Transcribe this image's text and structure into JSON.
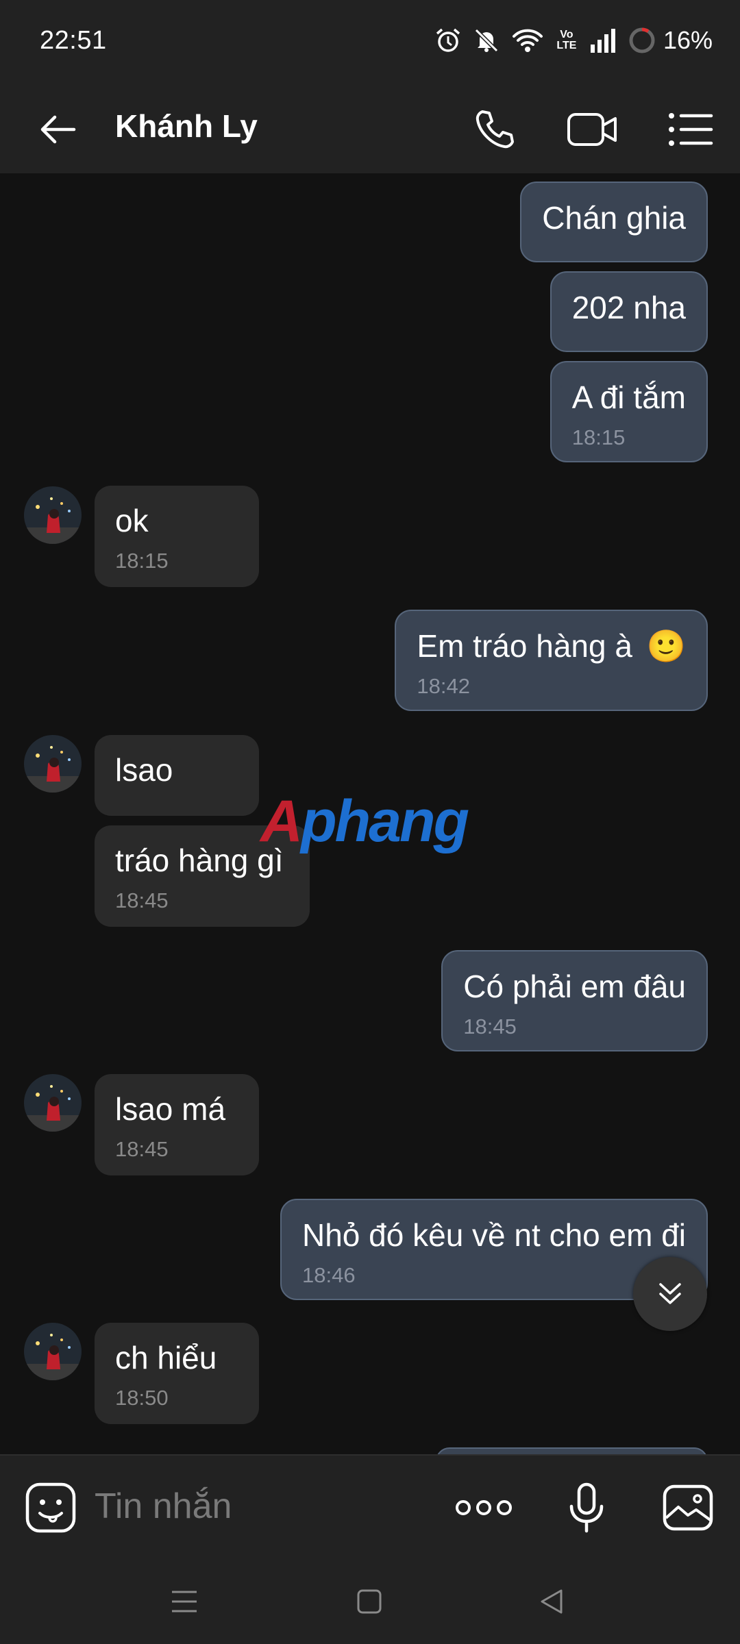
{
  "status_bar": {
    "time": "22:51",
    "volte_top": "Vo",
    "volte_bottom": "LTE",
    "battery_percent": "16%",
    "icons": [
      "alarm-icon",
      "mute-bell-icon",
      "wifi-icon",
      "volte-icon",
      "signal-icon",
      "battery-ring-icon"
    ]
  },
  "header": {
    "contact_name": "Khánh Ly",
    "icons": [
      "back-arrow-icon",
      "phone-icon",
      "video-call-icon",
      "menu-list-icon"
    ]
  },
  "messages": [
    {
      "direction": "out",
      "text": "Chán ghia",
      "time": ""
    },
    {
      "direction": "out",
      "text": "202 nha",
      "time": ""
    },
    {
      "direction": "out",
      "text": "A đi tắm",
      "time": "18:15"
    },
    {
      "direction": "in",
      "text": "ok",
      "time": "18:15"
    },
    {
      "direction": "out",
      "text": "Em tráo hàng à",
      "emoji": "🙂",
      "time": "18:42"
    },
    {
      "direction": "in",
      "text": "lsao",
      "time": ""
    },
    {
      "direction": "in",
      "text": "tráo hàng gì",
      "time": "18:45"
    },
    {
      "direction": "out",
      "text": "Có phải em đâu",
      "time": "18:45"
    },
    {
      "direction": "in",
      "text": "lsao má",
      "time": "18:45"
    },
    {
      "direction": "out",
      "text": "Nhỏ đó kêu về nt cho em đi",
      "time": "18:46"
    },
    {
      "direction": "in",
      "text": "ch hiểu",
      "time": "18:50"
    }
  ],
  "watermark": {
    "part1": "A",
    "part2": "phang"
  },
  "input_bar": {
    "placeholder": "Tin nhắn",
    "icons": [
      "sticker-icon",
      "more-dots-icon",
      "microphone-icon",
      "image-gallery-icon"
    ]
  },
  "nav_bar": {
    "icons": [
      "recent-apps-icon",
      "home-icon",
      "back-triangle-icon"
    ]
  },
  "colors": {
    "background": "#121212",
    "bar": "#222222",
    "outgoing_bubble": "#3a4453",
    "incoming_bubble": "#2a2a2a"
  }
}
